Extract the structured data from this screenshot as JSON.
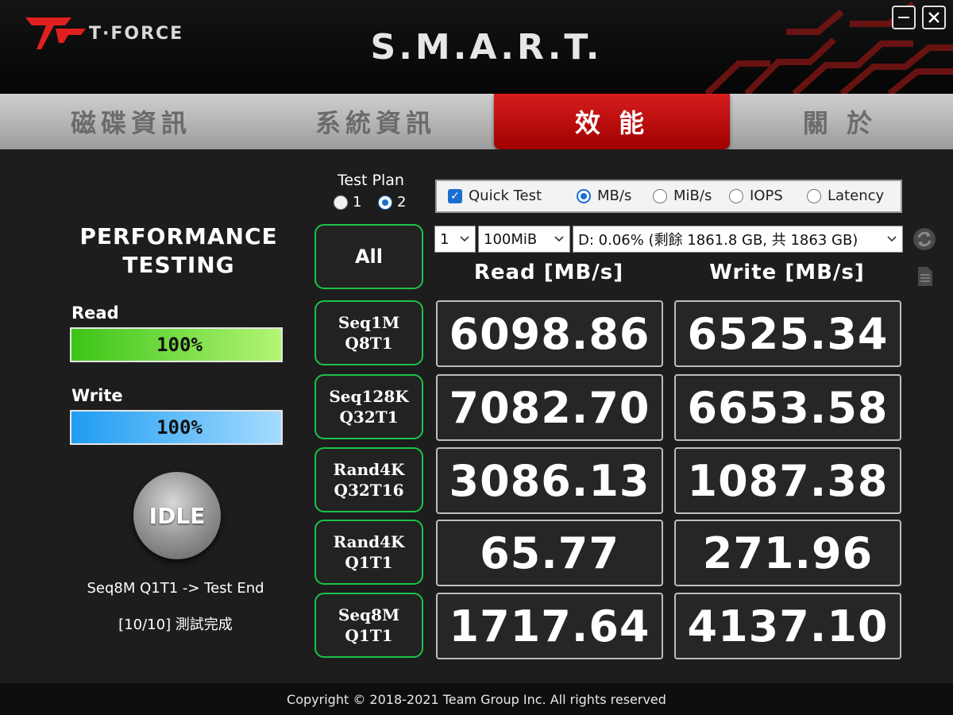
{
  "header": {
    "brand": "T·FORCE",
    "title": "S.M.A.R.T.",
    "minimize_icon": "minimize-icon",
    "close_icon": "close-icon"
  },
  "tabs": [
    {
      "label": "磁碟資訊",
      "active": false
    },
    {
      "label": "系統資訊",
      "active": false
    },
    {
      "label": "效 能",
      "active": true
    },
    {
      "label": "關 於",
      "active": false
    }
  ],
  "left": {
    "title_line1": "PERFORMANCE",
    "title_line2": "TESTING",
    "read_label": "Read",
    "read_progress": 100,
    "read_progress_text": "100%",
    "write_label": "Write",
    "write_progress": 100,
    "write_progress_text": "100%",
    "idle_label": "IDLE",
    "status_line1": "Seq8M Q1T1 -> Test End",
    "status_line2": "[10/10] 測試完成"
  },
  "test_plan": {
    "label": "Test Plan",
    "option1": "1",
    "option2": "2",
    "selected": "2"
  },
  "options": {
    "quick_test_label": "Quick Test",
    "quick_test_checked": true,
    "units": [
      "MB/s",
      "MiB/s",
      "IOPS",
      "Latency"
    ],
    "selected_unit": "MB/s"
  },
  "selects": {
    "count": "1",
    "size": "100MiB",
    "drive": "D: 0.06% (剩餘 1861.8 GB, 共 1863 GB)"
  },
  "side_icons": [
    "refresh-icon",
    "document-icon"
  ],
  "columns": {
    "read": "Read [MB/s]",
    "write": "Write [MB/s]"
  },
  "all_button": "All",
  "tests": [
    {
      "line1": "Seq1M",
      "line2": "Q8T1",
      "read": "6098.86",
      "write": "6525.34"
    },
    {
      "line1": "Seq128K",
      "line2": "Q32T1",
      "read": "7082.70",
      "write": "6653.58"
    },
    {
      "line1": "Rand4K",
      "line2": "Q32T16",
      "read": "3086.13",
      "write": "1087.38"
    },
    {
      "line1": "Rand4K",
      "line2": "Q1T1",
      "read": "65.77",
      "write": "271.96"
    },
    {
      "line1": "Seq8M",
      "line2": "Q1T1",
      "read": "1717.64",
      "write": "4137.10"
    }
  ],
  "footer": {
    "copyright": "Copyright © 2018-2021 Team Group Inc. All rights reserved"
  },
  "colors": {
    "accent_red": "#c40a0a",
    "test_border_green": "#1cc24a",
    "read_bar_green": "#5fd82e",
    "write_bar_blue": "#3aaaf5",
    "radio_blue": "#1a6fd0"
  }
}
